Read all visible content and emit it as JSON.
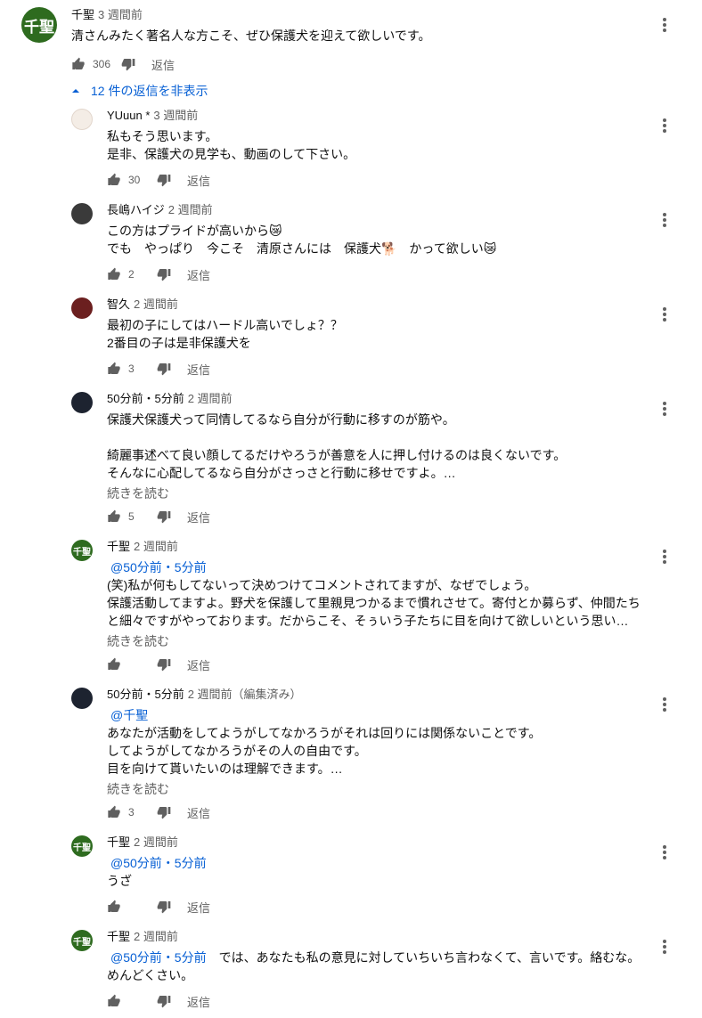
{
  "icons": {
    "like": "thumb-up-icon",
    "dislike": "thumb-down-icon",
    "menu": "more-vert-icon",
    "toggle": "chevron-up-icon"
  },
  "colors": {
    "link": "#065fd4",
    "secondary": "#606060",
    "avatar_green": "#2e6b1f"
  },
  "reply_label": "返信",
  "read_more": "続きを読む",
  "toggle_label": "12 件の返信を非表示",
  "main": {
    "avatar_text": "千聖",
    "author": "千聖",
    "time": "3 週間前",
    "text": "清さんみたく著名人な方こそ、ぜひ保護犬を迎えて欲しいです。",
    "likes": "306"
  },
  "replies": [
    {
      "author": "YUuun *",
      "time": "3 週間前",
      "mention": "",
      "text": "私もそう思います。\n是非、保護犬の見学も、動画のして下さい。",
      "likes": "30",
      "avatar_text": ""
    },
    {
      "author": "長嶋ハイジ",
      "time": "2 週間前",
      "mention": "",
      "text": "この方はプライドが高いから😿\nでも　やっぱり　今こそ　清原さんには　保護犬🐕　かって欲しい😿",
      "likes": "2",
      "avatar_text": ""
    },
    {
      "author": "智久",
      "time": "2 週間前",
      "mention": "",
      "text": "最初の子にしてはハードル高いでしょ？？\n2番目の子は是非保護犬を",
      "likes": "3",
      "avatar_text": ""
    },
    {
      "author": "50分前・5分前",
      "time": "2 週間前",
      "mention": "",
      "text": "保護犬保護犬って同情してるなら自分が行動に移すのが筋や。\n\n綺麗事述べて良い顔してるだけやろうが善意を人に押し付けるのは良くないです。\nそんなに心配してるなら自分がさっさと行動に移せですよ。…",
      "likes": "5",
      "avatar_text": ""
    },
    {
      "author": "千聖",
      "time": "2 週間前",
      "mention": "@50分前・5分前",
      "text": "(笑)私が何もしてないって決めつけてコメントされてますが、なぜでしょう。\n保護活動してますよ。野犬を保護して里親見つかるまで慣れさせて。寄付とか募らず、仲間たちと細々ですがやっております。だからこそ、そぅいう子たちに目を向けて欲しいという思い…",
      "likes": "",
      "avatar_text": "千聖"
    },
    {
      "author": "50分前・5分前",
      "time": "2 週間前（編集済み）",
      "mention": "@千聖",
      "text": "あなたが活動をしてようがしてなかろうがそれは回りには関係ないことです。\nしてようがしてなかろうがその人の自由です。\n目を向けて貰いたいのは理解できます。…",
      "likes": "3",
      "avatar_text": ""
    },
    {
      "author": "千聖",
      "time": "2 週間前",
      "mention": "@50分前・5分前",
      "text": "うざ",
      "likes": "",
      "avatar_text": "千聖"
    },
    {
      "author": "千聖",
      "time": "2 週間前",
      "mention": "@50分前・5分前",
      "text": "では、あなたも私の意見に対していちいち言わなくて、言いです。絡むな。\nめんどくさい。",
      "likes": "",
      "avatar_text": "千聖"
    }
  ]
}
